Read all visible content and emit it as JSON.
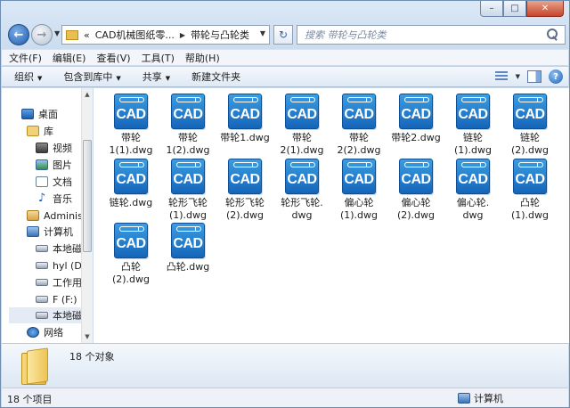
{
  "window": {
    "caption": {
      "minimize": "–",
      "maximize": "□",
      "close": "✕"
    }
  },
  "nav": {
    "back_glyph": "←",
    "forward_glyph": "→"
  },
  "address": {
    "prefix": "«",
    "parts": [
      "CAD机械图纸零...",
      "带轮与凸轮类"
    ]
  },
  "search": {
    "placeholder": "搜索 带轮与凸轮类"
  },
  "menu": [
    "文件(F)",
    "编辑(E)",
    "查看(V)",
    "工具(T)",
    "帮助(H)"
  ],
  "commands": [
    {
      "label": "组织",
      "dropdown": true
    },
    {
      "label": "包含到库中",
      "dropdown": true
    },
    {
      "label": "共享",
      "dropdown": true
    },
    {
      "label": "新建文件夹",
      "dropdown": false
    }
  ],
  "sidebar": {
    "items": [
      {
        "label": "桌面",
        "icon": "desktop-icon"
      },
      {
        "label": "库",
        "icon": "library-icon"
      },
      {
        "label": "视频",
        "icon": "video-icon"
      },
      {
        "label": "图片",
        "icon": "pictures-icon"
      },
      {
        "label": "文档",
        "icon": "documents-icon"
      },
      {
        "label": "音乐",
        "icon": "music-icon"
      },
      {
        "label": "Administ",
        "icon": "user-folder-icon"
      },
      {
        "label": "计算机",
        "icon": "computer-icon"
      },
      {
        "label": "本地磁盘",
        "icon": "drive-icon"
      },
      {
        "label": "hyl (D:)",
        "icon": "drive-icon"
      },
      {
        "label": "工作用盘",
        "icon": "drive-icon"
      },
      {
        "label": "F (F:)",
        "icon": "drive-icon"
      },
      {
        "label": "本地磁盘",
        "icon": "drive-icon"
      },
      {
        "label": "网络",
        "icon": "network-icon"
      }
    ]
  },
  "file_icon_text": "CAD",
  "files": [
    {
      "name": "带轮\n1(1).dwg"
    },
    {
      "name": "带轮\n1(2).dwg"
    },
    {
      "name": "带轮1.dwg"
    },
    {
      "name": "带轮\n2(1).dwg"
    },
    {
      "name": "带轮\n2(2).dwg"
    },
    {
      "name": "带轮2.dwg"
    },
    {
      "name": "链轮\n(1).dwg"
    },
    {
      "name": "链轮\n(2).dwg"
    },
    {
      "name": "链轮.dwg"
    },
    {
      "name": "轮形飞轮\n(1).dwg"
    },
    {
      "name": "轮形飞轮\n(2).dwg"
    },
    {
      "name": "轮形飞轮.\ndwg"
    },
    {
      "name": "偏心轮\n(1).dwg"
    },
    {
      "name": "偏心轮\n(2).dwg"
    },
    {
      "name": "偏心轮.\ndwg"
    },
    {
      "name": "凸轮\n(1).dwg"
    },
    {
      "name": "凸轮\n(2).dwg"
    },
    {
      "name": "凸轮.dwg"
    }
  ],
  "details": {
    "text": "18 个对象"
  },
  "status": {
    "left": "18 个项目",
    "right": "计算机"
  }
}
